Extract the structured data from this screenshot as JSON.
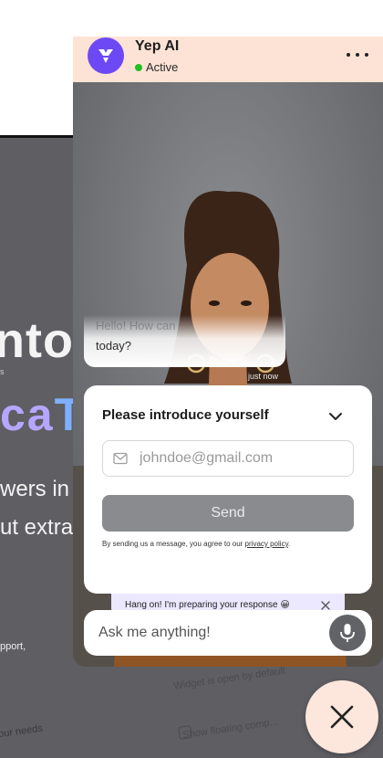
{
  "background_site": {
    "headline_fragment": "nto",
    "highlight_fragment_part1": "ca",
    "highlight_fragment_part2": "T",
    "small_fragment": "s",
    "line1": "wers in",
    "line2": "ut extra",
    "support_fragment": "pport,",
    "needs_fragment": "our needs",
    "widget_open_label": "Widget is open by default",
    "show_floating_label": "Show floating comp..."
  },
  "header": {
    "brand_name": "Yep AI",
    "status": "Active",
    "status_color": "#22c022",
    "logo_color": "#6d49f5",
    "header_bg": "#fde3d6"
  },
  "chat": {
    "bubble_faded": "Hello! How can",
    "bubble_text": "today?",
    "timestamp": "just now"
  },
  "intro_form": {
    "title": "Please introduce yourself",
    "email_placeholder": "johndoe@gmail.com",
    "send_label": "Send",
    "consent_prefix": "By sending us a message, you agree to our ",
    "privacy_link": "privacy policy",
    "consent_suffix": "."
  },
  "toast": {
    "message": "Hang on! I'm preparing your response 😀"
  },
  "composer": {
    "placeholder": "Ask me anything!"
  },
  "icons": {
    "logo": "yep-ai-logo-icon",
    "more": "more-dots-icon",
    "chevron": "chevron-down-icon",
    "email": "envelope-icon",
    "close_toast": "close-icon",
    "mic": "microphone-icon",
    "launcher": "close-icon"
  }
}
